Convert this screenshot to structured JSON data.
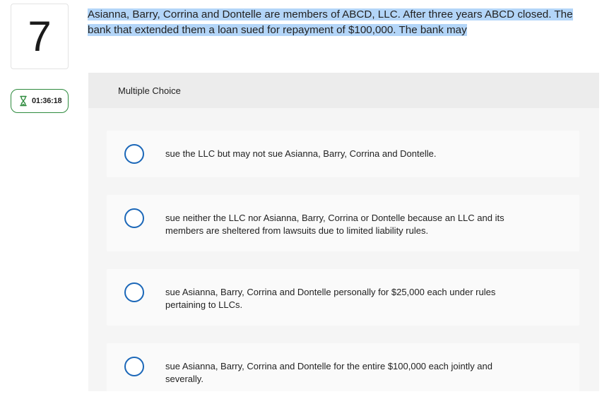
{
  "question": {
    "number": "7",
    "timer": "01:36:18",
    "prompt": "Asianna, Barry, Corrina and Dontelle are members of ABCD, LLC. After three years ABCD closed. The bank that extended them a loan sued for repayment of $100,000. The bank may"
  },
  "multiple_choice": {
    "header": "Multiple Choice",
    "options": [
      {
        "label": "sue the LLC but may not sue Asianna, Barry, Corrina and Dontelle."
      },
      {
        "label": "sue neither the LLC nor Asianna, Barry, Corrina or Dontelle because an LLC and its members are sheltered from lawsuits due to limited liability rules."
      },
      {
        "label": "sue Asianna, Barry, Corrina and Dontelle personally for $25,000 each under rules pertaining to LLCs."
      },
      {
        "label": "sue Asianna, Barry, Corrina and Dontelle for the entire $100,000 each jointly and severally."
      }
    ]
  },
  "colors": {
    "radio_border": "#1b67b8",
    "timer_border": "#2e8b3e",
    "selection_highlight": "#b3d5f8"
  }
}
